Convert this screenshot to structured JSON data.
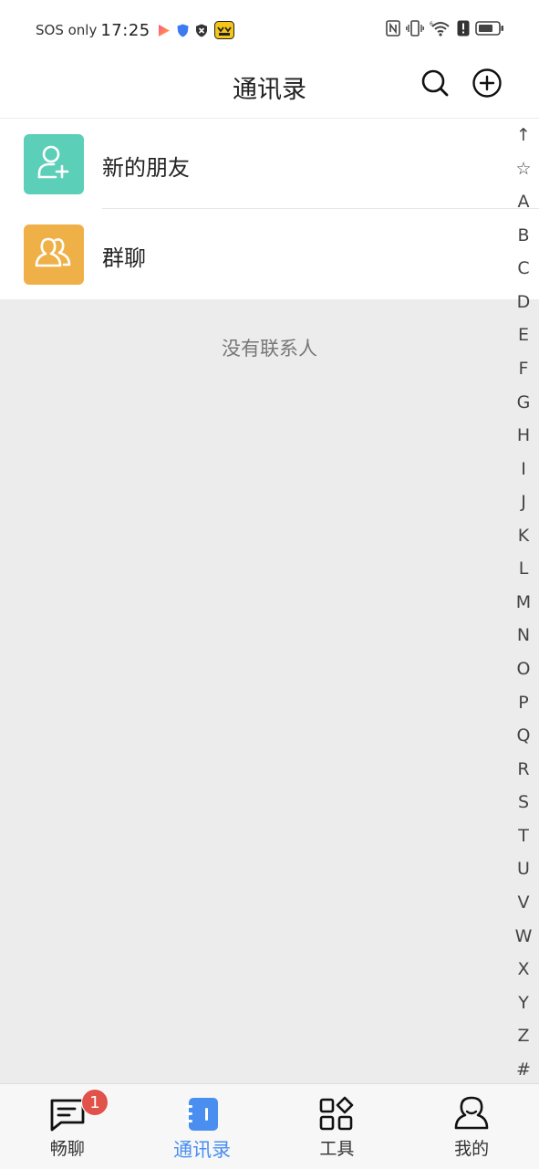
{
  "status_bar": {
    "carrier": "SOS only",
    "time": "17:25",
    "icons": [
      "play-app-icon",
      "shield-app-icon",
      "blocked-app-icon",
      "game-app-icon",
      "nfc-icon",
      "vibrate-icon",
      "wifi-icon",
      "alert-icon",
      "battery-icon"
    ]
  },
  "header": {
    "title": "通讯录",
    "search_icon": "search-icon",
    "add_icon": "add-circle-icon"
  },
  "entries": [
    {
      "label": "新的朋友",
      "icon": "add-friend-icon",
      "color": "#5ccfb8"
    },
    {
      "label": "群聊",
      "icon": "group-icon",
      "color": "#efb147"
    }
  ],
  "empty_state": "没有联系人",
  "alpha_index": [
    "↑",
    "☆",
    "A",
    "B",
    "C",
    "D",
    "E",
    "F",
    "G",
    "H",
    "I",
    "J",
    "K",
    "L",
    "M",
    "N",
    "O",
    "P",
    "Q",
    "R",
    "S",
    "T",
    "U",
    "V",
    "W",
    "X",
    "Y",
    "Z",
    "#"
  ],
  "bottom_nav": {
    "items": [
      {
        "label": "畅聊",
        "icon": "chat-icon",
        "badge": "1",
        "active": false
      },
      {
        "label": "通讯录",
        "icon": "contacts-book-icon",
        "active": true
      },
      {
        "label": "工具",
        "icon": "tools-grid-icon",
        "active": false
      },
      {
        "label": "我的",
        "icon": "profile-icon",
        "active": false
      }
    ]
  },
  "colors": {
    "accent": "#4a8ff0",
    "badge": "#e0524a",
    "background": "#ececec"
  }
}
